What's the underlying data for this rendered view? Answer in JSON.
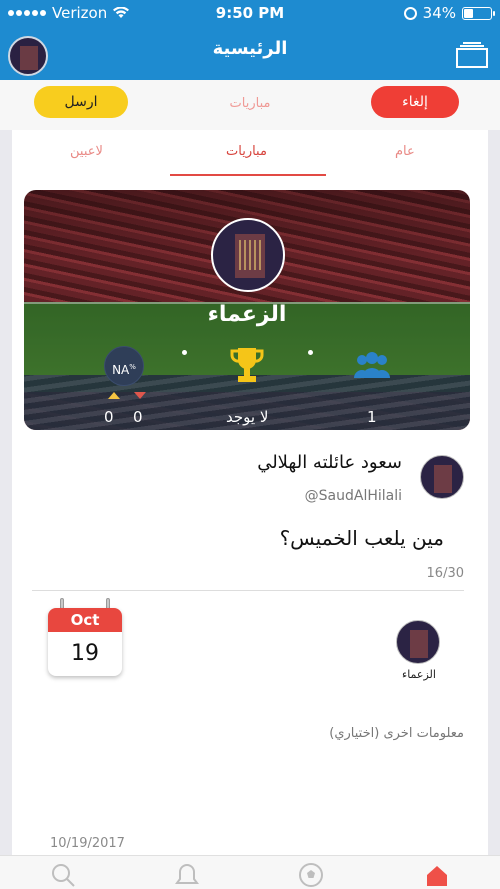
{
  "status_bar": {
    "carrier": "Verizon",
    "time": "9:50 PM",
    "battery": "34%",
    "battery_level": 0.34
  },
  "nav": {
    "title": "الرئيسية"
  },
  "actions": {
    "send_label": "ارسل",
    "title": "مباريات",
    "cancel_label": "إلغاء"
  },
  "tabs": [
    {
      "label": "لاعبين"
    },
    {
      "label": "مباريات",
      "active": true
    },
    {
      "label": "عام"
    }
  ],
  "team": {
    "name": "الزعماء",
    "rating": "NA",
    "rating_suffix": "%",
    "up_votes": "0",
    "down_votes": "0",
    "trophies": "لا يوجد",
    "members": "1"
  },
  "post": {
    "author_name": "سعود عائلته الهلالي",
    "author_handle": "@SaudAlHilali",
    "text": "مين يلعب الخميس؟",
    "char_count": "16/30"
  },
  "match": {
    "month": "Oct",
    "day": "19",
    "team_label": "الزعماء",
    "more_info_placeholder": "معلومات اخرى (اختياري)"
  },
  "footer": {
    "date": "10/19/2017"
  },
  "colors": {
    "primary_blue": "#1e8bd0",
    "send_yellow": "#f8cd1e",
    "cancel_red": "#ef3e36",
    "calendar_red": "#e8473f"
  },
  "icons": {
    "tabbar": [
      "search-icon",
      "bell-icon",
      "soccer-ball-icon",
      "home-icon"
    ]
  }
}
